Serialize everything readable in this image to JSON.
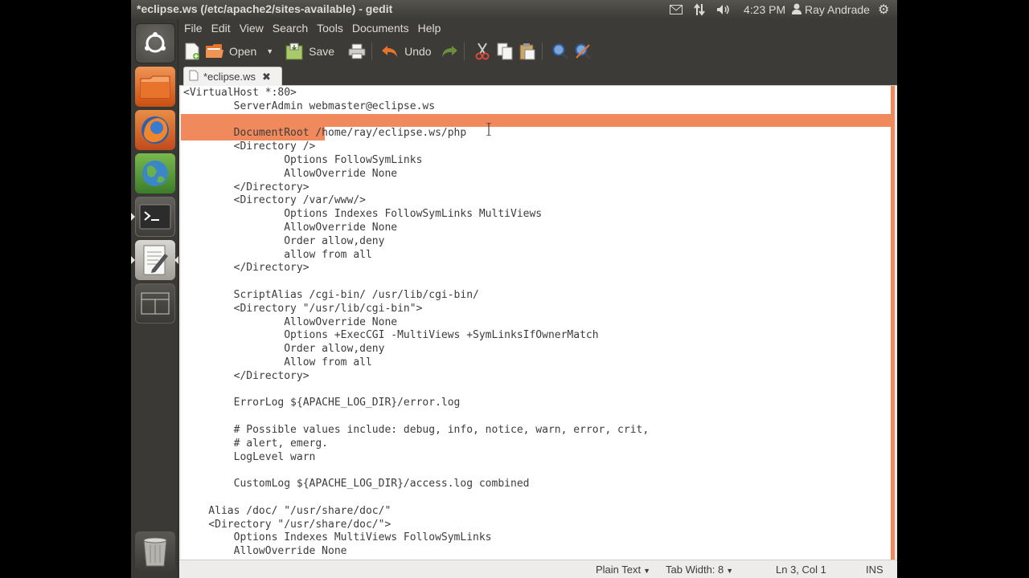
{
  "top_panel": {
    "window_title": "*eclipse.ws (/etc/apache2/sites-available) - gedit",
    "clock": "4:23 PM",
    "user": "Ray Andrade",
    "icons": [
      "mail-icon",
      "network-icon",
      "volume-icon",
      "gear-icon"
    ]
  },
  "launcher": {
    "items": [
      "ubuntu-home",
      "files",
      "firefox",
      "web-browser",
      "terminal",
      "gedit",
      "workspace-switcher",
      "trash"
    ]
  },
  "menubar": {
    "items": [
      "File",
      "Edit",
      "View",
      "Search",
      "Tools",
      "Documents",
      "Help"
    ]
  },
  "toolbar": {
    "open_label": "Open",
    "save_label": "Save",
    "undo_label": "Undo"
  },
  "tab": {
    "label": "*eclipse.ws"
  },
  "editor": {
    "lines": [
      "<VirtualHost *:80>",
      "        ServerAdmin webmaster@eclipse.ws",
      "",
      "        DocumentRoot /home/ray/eclipse.ws/php",
      "        <Directory />",
      "                Options FollowSymLinks",
      "                AllowOverride None",
      "        </Directory>",
      "        <Directory /var/www/>",
      "                Options Indexes FollowSymLinks MultiViews",
      "                AllowOverride None",
      "                Order allow,deny",
      "                allow from all",
      "        </Directory>",
      "",
      "        ScriptAlias /cgi-bin/ /usr/lib/cgi-bin/",
      "        <Directory \"/usr/lib/cgi-bin\">",
      "                AllowOverride None",
      "                Options +ExecCGI -MultiViews +SymLinksIfOwnerMatch",
      "                Order allow,deny",
      "                Allow from all",
      "        </Directory>",
      "",
      "        ErrorLog ${APACHE_LOG_DIR}/error.log",
      "",
      "        # Possible values include: debug, info, notice, warn, error, crit,",
      "        # alert, emerg.",
      "        LogLevel warn",
      "",
      "        CustomLog ${APACHE_LOG_DIR}/access.log combined",
      "",
      "    Alias /doc/ \"/usr/share/doc/\"",
      "    <Directory \"/usr/share/doc/\">",
      "        Options Indexes MultiViews FollowSymLinks",
      "        AllowOverride None"
    ]
  },
  "statusbar": {
    "language": "Plain Text",
    "tab_width": "Tab Width: 8",
    "position": "Ln 3, Col 1",
    "mode": "INS"
  },
  "colors": {
    "highlight": "#f08a5d",
    "panel": "#3c3b37",
    "text": "#dfdbd2"
  }
}
